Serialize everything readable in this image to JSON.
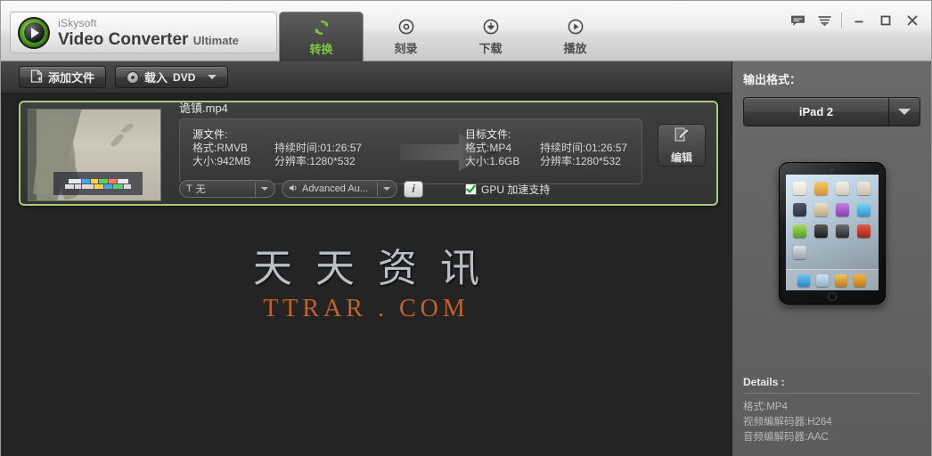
{
  "window": {
    "brand": "iSkysoft",
    "product": "Video Converter",
    "product_suffix": "Ultimate",
    "controls": {
      "feedback": "feedback-icon",
      "menu": "menu-icon",
      "minimize": "–",
      "maximize": "☐",
      "close": "✕"
    }
  },
  "tabs": [
    {
      "label": "转换",
      "icon": "convert-icon",
      "active": true
    },
    {
      "label": "刻录",
      "icon": "burn-icon",
      "active": false
    },
    {
      "label": "下载",
      "icon": "download-icon",
      "active": false
    },
    {
      "label": "播放",
      "icon": "play-icon",
      "active": false
    }
  ],
  "toolbar": {
    "add_file": "添加文件",
    "load_dvd_prefix": "载入",
    "load_dvd_suffix": "DVD"
  },
  "file_row": {
    "name": "诡镇.mp4",
    "source": {
      "title": "源文件:",
      "format_label": "格式:RMVB",
      "size_label": "大小:942MB",
      "duration_label": "持续时间:01:26:57",
      "resolution_label": "分辨率:1280*532"
    },
    "target": {
      "title": "目标文件:",
      "format_label": "格式:MP4",
      "size_label": "大小:1.6GB",
      "duration_label": "持续时间:01:26:57",
      "resolution_label": "分辨率:1280*532"
    },
    "edit_button": "编辑",
    "subtitle_select": "无",
    "audio_select": "Advanced Au...",
    "info_button": "i",
    "gpu_label": "GPU 加速支持",
    "gpu_checked": true
  },
  "watermark": {
    "cn": "天天资讯",
    "en": "TTRAR . COM"
  },
  "right_panel": {
    "output_format_title": "输出格式：",
    "selected_format": "iPad 2",
    "details_title": "Details :",
    "details": [
      "格式:MP4",
      "视频编解码器:H264",
      "音频编解码器:AAC"
    ]
  },
  "colors": {
    "accent_green": "#7ac943",
    "row_border": "#a9cc7c",
    "watermark_orange": "#c4622a",
    "panel_bg": "#636363",
    "main_bg": "#242424"
  }
}
